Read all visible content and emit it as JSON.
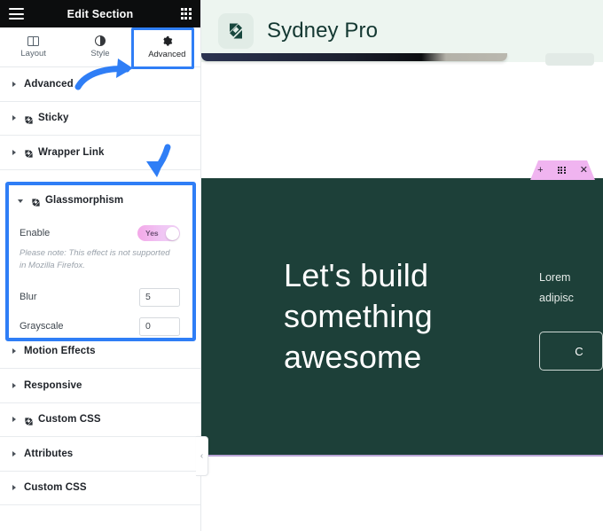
{
  "editor": {
    "header": {
      "title": "Edit Section",
      "menu_icon": "hamburger-icon",
      "apps_icon": "grid-apps-icon"
    },
    "tabs": [
      {
        "label": "Layout",
        "icon": "layout-columns-icon",
        "active": false
      },
      {
        "label": "Style",
        "icon": "contrast-circle-icon",
        "active": false
      },
      {
        "label": "Advanced",
        "icon": "gear-icon",
        "active": true
      }
    ],
    "sections": [
      {
        "label": "Advanced",
        "pro": false,
        "open": false
      },
      {
        "label": "Sticky",
        "pro": true,
        "open": false
      },
      {
        "label": "Wrapper Link",
        "pro": true,
        "open": false
      }
    ],
    "glassmorphism": {
      "label": "Glassmorphism",
      "pro": true,
      "open": true,
      "enable_label": "Enable",
      "enable_value": "Yes",
      "note": "Please note: This effect is not supported in Mozilla Firefox.",
      "fields": [
        {
          "label": "Blur",
          "value": "5"
        },
        {
          "label": "Grayscale",
          "value": "0"
        }
      ]
    },
    "sections_after": [
      {
        "label": "Motion Effects",
        "pro": false,
        "open": false
      },
      {
        "label": "Responsive",
        "pro": false,
        "open": false
      },
      {
        "label": "Custom CSS",
        "pro": true,
        "open": false
      },
      {
        "label": "Attributes",
        "pro": false,
        "open": false
      },
      {
        "label": "Custom CSS",
        "pro": false,
        "open": false
      }
    ],
    "collapse_label": "‹"
  },
  "annotations": {
    "color": "#2f7ef6",
    "highlight_tab": "Advanced",
    "highlight_panel": "Glassmorphism",
    "arrows": [
      "arrow-to-advanced-tab",
      "arrow-to-glassmorphism"
    ]
  },
  "preview": {
    "site": {
      "brand": "Sydney Pro",
      "logo_icon": "sydney-s-logo-icon",
      "header_bg": "#edf5f0"
    },
    "section_toolbar": {
      "add_icon": "plus-icon",
      "drag_icon": "drag-grid-icon",
      "close_icon": "close-x-icon",
      "bg": "#f0b4f0"
    },
    "hero": {
      "bg": "#1d4039",
      "title_line1": "Let's build",
      "title_line2": "something",
      "title_line3": "awesome",
      "paragraph_line1": "Lorem",
      "paragraph_line2": "adipisc",
      "button_label": "C"
    }
  }
}
